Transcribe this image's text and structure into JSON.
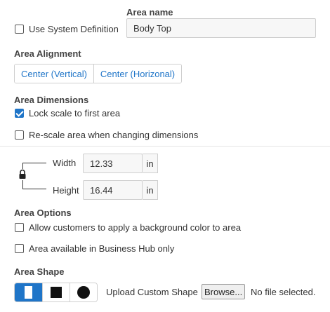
{
  "area_name": {
    "label": "Area name",
    "value": "Body Top"
  },
  "use_system_definition": {
    "label": "Use System Definition",
    "checked": false
  },
  "area_alignment": {
    "label": "Area Alignment",
    "buttons": [
      "Center (Vertical)",
      "Center (Horizonal)"
    ]
  },
  "area_dimensions": {
    "label": "Area Dimensions",
    "lock_scale": {
      "label": "Lock scale to first area",
      "checked": true
    },
    "rescale": {
      "label": "Re-scale area when changing dimensions",
      "checked": false
    },
    "width": {
      "label": "Width",
      "value": "12.33",
      "unit": "in"
    },
    "height": {
      "label": "Height",
      "value": "16.44",
      "unit": "in"
    },
    "lock_icon": "padlock-icon"
  },
  "area_options": {
    "label": "Area Options",
    "background_color": {
      "label": "Allow customers to apply a background color to area",
      "checked": false
    },
    "business_hub": {
      "label": "Area available in Business Hub only",
      "checked": false
    }
  },
  "area_shape": {
    "label": "Area Shape",
    "shapes": [
      "rectangle",
      "square",
      "circle"
    ],
    "selected": "rectangle",
    "upload_label": "Upload Custom Shape",
    "browse_label": "Browse...",
    "file_status": "No file selected."
  },
  "colors": {
    "accent": "#1f75c8",
    "border": "#cfcfcf",
    "input_bg": "#f7f7f7"
  }
}
